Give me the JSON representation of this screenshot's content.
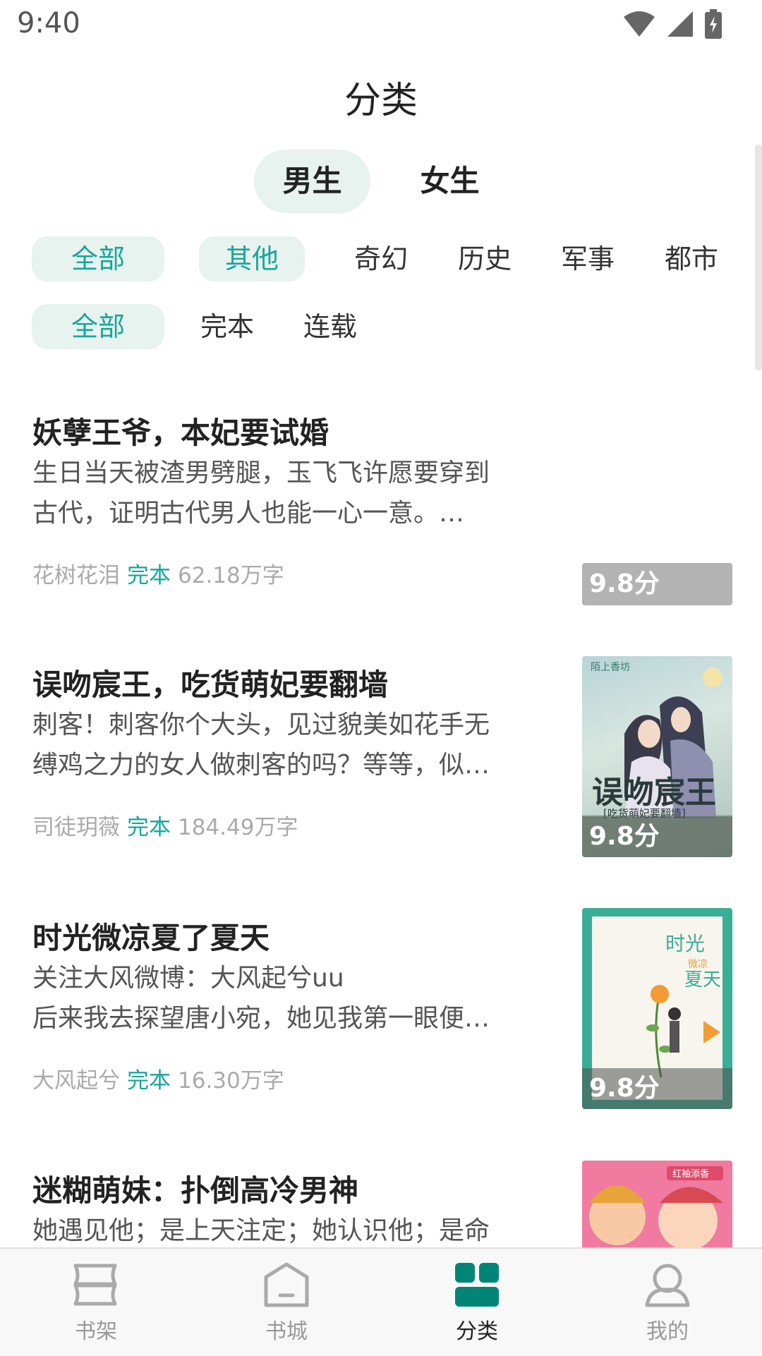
{
  "status_bar": {
    "time": "9:40",
    "icons": [
      "wifi-icon",
      "signal-icon",
      "battery-icon"
    ]
  },
  "page_title": "分类",
  "gender_tabs": [
    {
      "label": "男生",
      "selected": true
    },
    {
      "label": "女生",
      "selected": false
    }
  ],
  "category_filters": [
    {
      "label": "全部",
      "selected": true
    },
    {
      "label": "其他",
      "selected": true
    },
    {
      "label": "奇幻",
      "selected": false
    },
    {
      "label": "历史",
      "selected": false
    },
    {
      "label": "军事",
      "selected": false
    },
    {
      "label": "都市",
      "selected": false
    }
  ],
  "status_filters": [
    {
      "label": "全部",
      "selected": true
    },
    {
      "label": "完本",
      "selected": false
    },
    {
      "label": "连载",
      "selected": false
    }
  ],
  "books": [
    {
      "title": "妖孽王爷，本妃要试婚",
      "desc_line1": "生日当天被渣男劈腿，玉飞飞许愿要穿到",
      "desc_line2": "古代，证明古代男人也能一心一意。…",
      "author": "花树花泪",
      "status": "完本",
      "words": "62.18万字",
      "score": "9.8分",
      "cover": "none"
    },
    {
      "title": "误吻宸王，吃货萌妃要翻墙",
      "desc_line1": "刺客！刺客你个大头，见过貌美如花手无",
      "desc_line2": "缚鸡之力的女人做刺客的吗？等等，似…",
      "author": "司徒玥薇",
      "status": "完本",
      "words": "184.49万字",
      "score": "9.8分",
      "cover_title": "误吻宸王",
      "cover_subtitle": "[吃货萌妃要翻墙]",
      "cover_publisher": "陌上香坊"
    },
    {
      "title": "时光微凉夏了夏天",
      "desc_line1": "关注大风微博：大风起兮uu",
      "desc_line2": "后来我去探望唐小宛，她见我第一眼便…",
      "author": "大风起兮",
      "status": "完本",
      "words": "16.30万字",
      "score": "9.8分",
      "cover_title_1": "时光",
      "cover_title_2": "微凉",
      "cover_title_3": "夏天"
    },
    {
      "title": "迷糊萌妹：扑倒高冷男神",
      "desc_line1": "她遇见他；是上天注定；她认识他；是命",
      "cover_publisher": "红袖添香"
    }
  ],
  "tab_bar": [
    {
      "label": "书架",
      "icon": "bookshelf-icon",
      "active": false
    },
    {
      "label": "书城",
      "icon": "bookstore-icon",
      "active": false
    },
    {
      "label": "分类",
      "icon": "category-grid-icon",
      "active": true
    },
    {
      "label": "我的",
      "icon": "profile-icon",
      "active": false
    }
  ],
  "colors": {
    "accent": "#16a69a",
    "selected_bg": "#e8f2ef",
    "tab_active": "#008577"
  }
}
